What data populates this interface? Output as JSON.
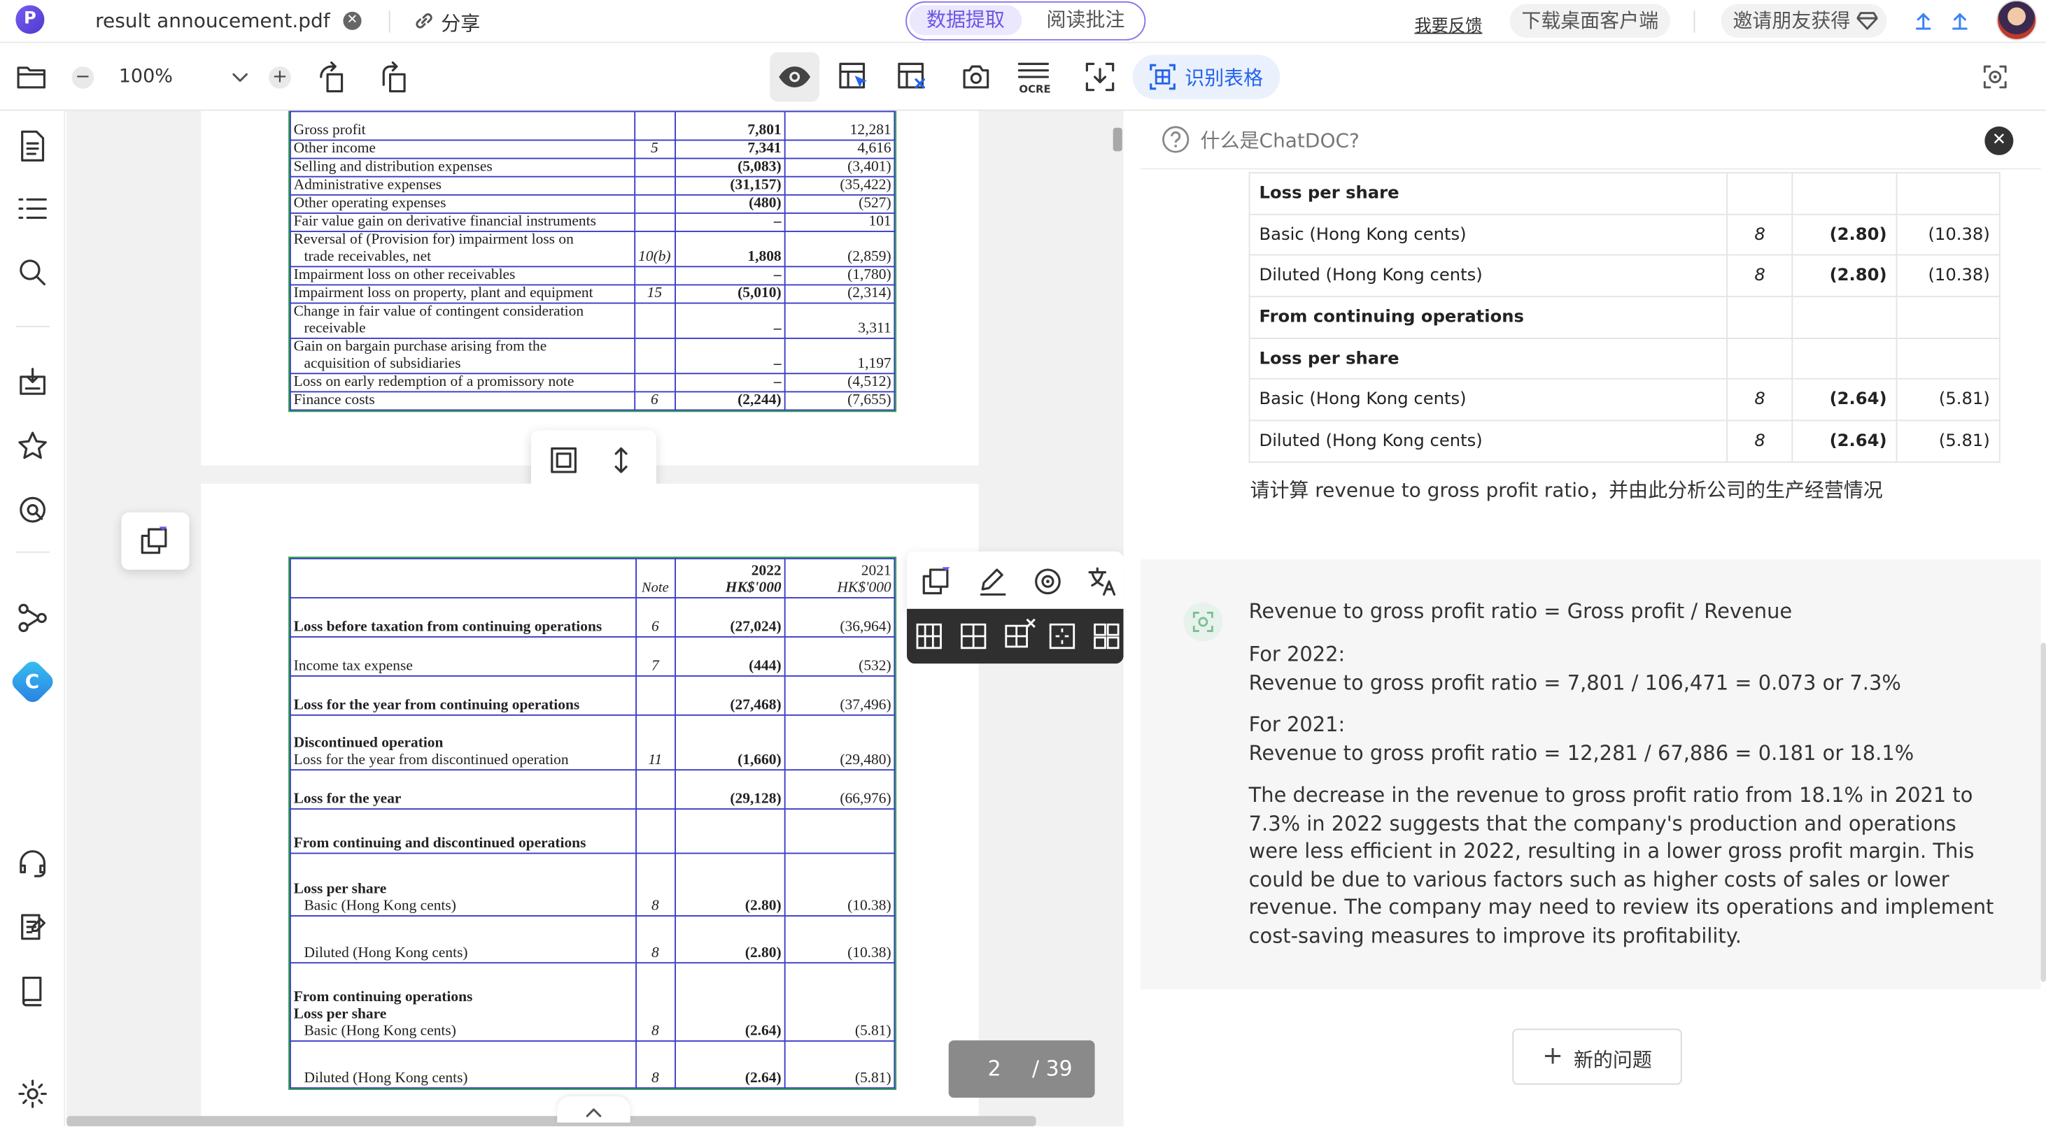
{
  "topbar": {
    "file_name": "result annoucement.pdf",
    "share_label": "分享",
    "mode_tabs": [
      "数据提取",
      "阅读批注"
    ],
    "feedback_label": "我要反馈",
    "download_label": "下载桌面客户端",
    "invite_label": "邀请朋友获得"
  },
  "toolbar": {
    "zoom": "100%",
    "recognize_table_label": "识别表格"
  },
  "pdf_table1": {
    "rows": [
      {
        "label": "Gross profit",
        "note": "",
        "y2022": "7,801",
        "y2021": "12,281"
      },
      {
        "label": "Other income",
        "note": "5",
        "y2022": "7,341",
        "y2021": "4,616"
      },
      {
        "label": "Selling and distribution expenses",
        "note": "",
        "y2022": "(5,083)",
        "y2021": "(3,401)"
      },
      {
        "label": "Administrative expenses",
        "note": "",
        "y2022": "(31,157)",
        "y2021": "(35,422)"
      },
      {
        "label": "Other operating expenses",
        "note": "",
        "y2022": "(480)",
        "y2021": "(527)"
      },
      {
        "label": "Fair value gain on derivative financial instruments",
        "note": "",
        "y2022": "–",
        "y2021": "101"
      },
      {
        "label": "Reversal of (Provision for) impairment loss on",
        "label2": "trade receivables, net",
        "note": "10(b)",
        "y2022": "1,808",
        "y2021": "(2,859)"
      },
      {
        "label": "Impairment loss on other receivables",
        "note": "",
        "y2022": "–",
        "y2021": "(1,780)"
      },
      {
        "label": "Impairment loss on property, plant and equipment",
        "note": "15",
        "y2022": "(5,010)",
        "y2021": "(2,314)"
      },
      {
        "label": "Change in fair value of contingent consideration",
        "label2": "receivable",
        "note": "",
        "y2022": "–",
        "y2021": "3,311"
      },
      {
        "label": "Gain on bargain purchase arising from the",
        "label2": "acquisition of subsidiaries",
        "note": "",
        "y2022": "–",
        "y2021": "1,197"
      },
      {
        "label": "Loss on early redemption of a promissory note",
        "note": "",
        "y2022": "–",
        "y2021": "(4,512)"
      },
      {
        "label": "Finance costs",
        "note": "6",
        "y2022": "(2,244)",
        "y2021": "(7,655)"
      }
    ]
  },
  "pdf_table2": {
    "header": {
      "note": "Note",
      "y2022": "2022",
      "y2021": "2021",
      "unit": "HK$'000"
    },
    "rows": [
      {
        "label": "Loss before taxation from continuing operations",
        "note": "6",
        "y2022": "(27,024)",
        "y2021": "(36,964)"
      },
      {
        "label": "Income tax expense",
        "note": "7",
        "y2022": "(444)",
        "y2021": "(532)"
      },
      {
        "label": "Loss for the year from continuing operations",
        "note": "",
        "y2022": "(27,468)",
        "y2021": "(37,496)"
      },
      {
        "label": "Discontinued operation",
        "label2": "Loss for the year from discontinued operation",
        "note": "11",
        "y2022": "(1,660)",
        "y2021": "(29,480)"
      },
      {
        "label": "Loss for the year",
        "note": "",
        "y2022": "(29,128)",
        "y2021": "(66,976)"
      },
      {
        "label": "From continuing and discontinued operations",
        "note": "",
        "y2022": "",
        "y2021": ""
      },
      {
        "label": "Loss per share",
        "label2": "Basic (Hong Kong cents)",
        "note": "8",
        "y2022": "(2.80)",
        "y2021": "(10.38)"
      },
      {
        "label": "Diluted (Hong Kong cents)",
        "note": "8",
        "y2022": "(2.80)",
        "y2021": "(10.38)"
      },
      {
        "label": "From continuing operations",
        "label2": "Loss per share",
        "label3": "Basic (Hong Kong cents)",
        "note": "8",
        "y2022": "(2.64)",
        "y2021": "(5.81)"
      },
      {
        "label": "Diluted (Hong Kong cents)",
        "note": "8",
        "y2022": "(2.64)",
        "y2021": "(5.81)"
      }
    ]
  },
  "page_indicator": {
    "current": "2",
    "total": "/ 39"
  },
  "chat": {
    "help_label": "什么是ChatDOC?",
    "answer_table": [
      {
        "label": "Loss per share",
        "note": "",
        "y2022": "",
        "y2021": "",
        "bold": true
      },
      {
        "label": "Basic (Hong Kong cents)",
        "note": "8",
        "y2022": "(2.80)",
        "y2021": "(10.38)",
        "bold": false
      },
      {
        "label": "Diluted (Hong Kong cents)",
        "note": "8",
        "y2022": "(2.80)",
        "y2021": "(10.38)",
        "bold": false
      },
      {
        "label": "From continuing operations",
        "note": "",
        "y2022": "",
        "y2021": "",
        "bold": true
      },
      {
        "label": "Loss per share",
        "note": "",
        "y2022": "",
        "y2021": "",
        "bold": true
      },
      {
        "label": "Basic (Hong Kong cents)",
        "note": "8",
        "y2022": "(2.64)",
        "y2021": "(5.81)",
        "bold": false
      },
      {
        "label": "Diluted (Hong Kong cents)",
        "note": "8",
        "y2022": "(2.64)",
        "y2021": "(5.81)",
        "bold": false
      }
    ],
    "user_question": "请计算 revenue to gross profit ratio，并由此分析公司的生产经营情况",
    "answer_lines": [
      "Revenue to gross profit ratio = Gross profit / Revenue",
      "For 2022:",
      "Revenue to gross profit ratio = 7,801 / 106,471 = 0.073 or 7.3%",
      "For 2021:",
      "Revenue to gross profit ratio = 12,281 / 67,886 = 0.181 or 18.1%",
      "The decrease in the revenue to gross profit ratio from 18.1% in 2021 to 7.3% in 2022 suggests that the company's production and operations were less efficient in 2022, resulting in a lower gross profit margin. This could be due to various factors such as higher costs of sales or lower revenue. The company may need to review its operations and implement cost-saving measures to improve its profitability."
    ],
    "new_question_label": "新的问题"
  },
  "colors": {
    "brand": "#5b47e0",
    "table_border": "#3a3ac8",
    "selection_green": "#2ea043"
  }
}
